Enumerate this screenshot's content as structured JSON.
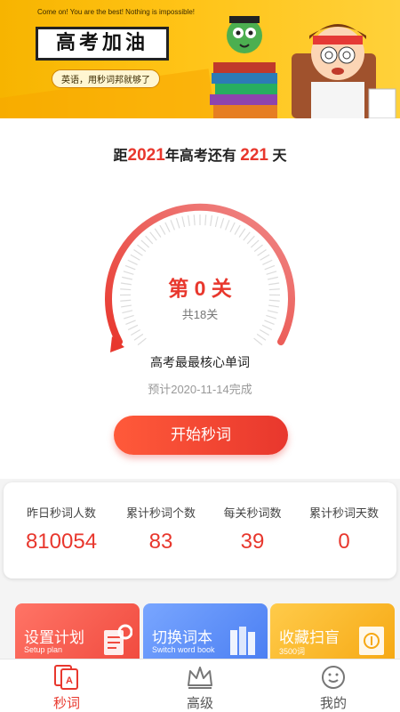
{
  "banner": {
    "motto": "Come on! You are the best! Nothing is impossible!",
    "title": "高考加油",
    "slogan": "英语，用秒词邦就够了"
  },
  "countdown": {
    "prefix": "距",
    "year": "2021",
    "middle": "年高考还有",
    "days": "221",
    "suffix": "天"
  },
  "progress": {
    "level_text": "第 0 关",
    "total_text": "共18关",
    "fraction": 0
  },
  "book": {
    "name": "高考最最核心单词",
    "finish_text": "预计2020-11-14完成"
  },
  "start_button": "开始秒词",
  "stats": [
    {
      "label": "昨日秒词人数",
      "value": "810054"
    },
    {
      "label": "累计秒词个数",
      "value": "83"
    },
    {
      "label": "每关秒词数",
      "value": "39"
    },
    {
      "label": "累计秒词天数",
      "value": "0"
    }
  ],
  "tiles": [
    {
      "title": "设置计划",
      "subtitle": "Setup plan",
      "icon": "plan-icon"
    },
    {
      "title": "切换词本",
      "subtitle": "Switch word book",
      "icon": "books-icon"
    },
    {
      "title": "收藏扫盲",
      "subtitle": "3500词",
      "icon": "favorite-book-icon"
    }
  ],
  "nav": [
    {
      "label": "秒词",
      "icon": "word-card-icon",
      "active": true
    },
    {
      "label": "高级",
      "icon": "crown-icon",
      "active": false
    },
    {
      "label": "我的",
      "icon": "smiley-icon",
      "active": false
    }
  ],
  "colors": {
    "accent": "#e8372d",
    "banner": "#ffc316"
  }
}
